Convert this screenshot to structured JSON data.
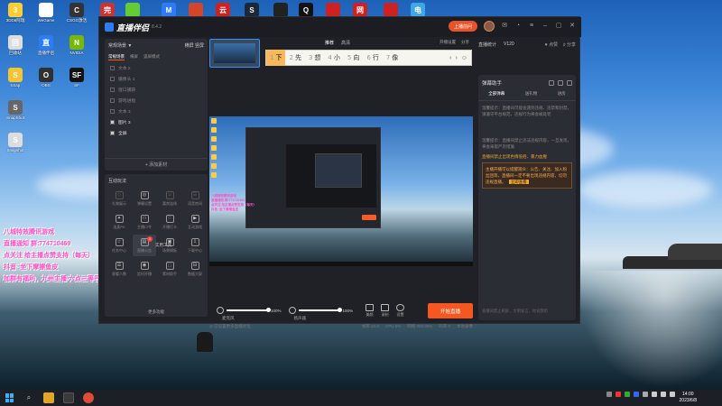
{
  "desktop": {
    "icons": [
      {
        "label": "3DD6阿瑞",
        "color": "#ffcc33",
        "glyph": "3"
      },
      {
        "label": "WeGame",
        "color": "#ffffff",
        "glyph": "W"
      },
      {
        "label": "CSGO激活",
        "color": "#333333",
        "glyph": "C"
      },
      {
        "label": "完美",
        "color": "#cc3333",
        "glyph": "完"
      },
      {
        "label": "",
        "color": "#66cc33",
        "glyph": ""
      },
      {
        "label": "Microsoft",
        "color": "#2d7bf5",
        "glyph": "M"
      },
      {
        "label": "",
        "color": "#d4462b",
        "glyph": ""
      },
      {
        "label": "网易云",
        "color": "#cc2222",
        "glyph": "云"
      },
      {
        "label": "Steam",
        "color": "#1b2838",
        "glyph": "S"
      },
      {
        "label": "",
        "color": "#222222",
        "glyph": ""
      },
      {
        "label": "QQ",
        "color": "#111111",
        "glyph": "Q"
      },
      {
        "label": "",
        "color": "#cc2222",
        "glyph": ""
      },
      {
        "label": "网易",
        "color": "#cc2222",
        "glyph": "网"
      },
      {
        "label": "",
        "color": "#cc2222",
        "glyph": ""
      },
      {
        "label": "此电脑",
        "color": "#3fa7e8",
        "glyph": "电"
      },
      {
        "label": "回收站",
        "color": "#dddddd",
        "glyph": "回"
      },
      {
        "label": "直播伴侣",
        "color": "#2d7bf5",
        "glyph": "直"
      },
      {
        "label": "NVIDIA",
        "color": "#76b900",
        "glyph": "N"
      },
      {
        "label": "Snap",
        "color": "#f4c431",
        "glyph": "S"
      },
      {
        "label": "OBS",
        "color": "#303030",
        "glyph": "O"
      },
      {
        "label": "SF",
        "color": "#111111",
        "glyph": "SF"
      },
      {
        "label": "SnapShot",
        "color": "#666666",
        "glyph": "S"
      },
      {
        "label": "Snapshot",
        "color": "#dddddd",
        "glyph": "S"
      }
    ]
  },
  "overlay": {
    "lines": [
      "八城特效腾讯游戏",
      "直播通知 群:774710469",
      "点关注 给主播点赞支持（每天）",
      "抖音 :坐下摩擦鱼皮",
      "加群有福利，九州主播 六点三等巴江"
    ]
  },
  "app": {
    "name": "直播伴侣",
    "version": "8.4.2",
    "live_label": "上播前问",
    "left": {
      "scene_title": "常规场景 ▼",
      "scene_actions": [
        "横屏",
        "竖屏"
      ],
      "tabs": [
        "常规场景",
        "横屏",
        "竖屏模式"
      ],
      "sources": [
        {
          "label": "文本 2",
          "on": false
        },
        {
          "label": "摄像头 1",
          "on": false
        },
        {
          "label": "窗口捕获",
          "on": false
        },
        {
          "label": "游戏进程",
          "on": false
        },
        {
          "label": "文本 3",
          "on": false
        },
        {
          "label": "图片 3",
          "on": true
        },
        {
          "label": "全屏",
          "on": true
        }
      ],
      "add_source": "+ 添加素材",
      "tools_title": "互动玩法",
      "tools": [
        {
          "label": "礼物展示",
          "icon": "◇",
          "dim": true
        },
        {
          "label": "弹幕设置",
          "icon": "◎",
          "dim": false
        },
        {
          "label": "嘉宾连线",
          "icon": "☺",
          "dim": true
        },
        {
          "label": "语音房间",
          "icon": "☷",
          "dim": true
        },
        {
          "label": "连麦PK",
          "icon": "✦",
          "dim": false
        },
        {
          "label": "主播口令",
          "icon": "□",
          "dim": false
        },
        {
          "label": "开播打卡",
          "icon": "♡",
          "dim": false
        },
        {
          "label": "互动游戏",
          "icon": "▶",
          "dim": false
        },
        {
          "label": "任务中心",
          "icon": "☆",
          "dim": false
        },
        {
          "label": "直播公告",
          "icon": "▤",
          "dim": false,
          "hi": true,
          "badge": "1"
        },
        {
          "label": "场景模板",
          "icon": "▣",
          "dim": false
        },
        {
          "label": "下载中心",
          "icon": "⇩",
          "dim": false
        },
        {
          "label": "观看人数",
          "icon": "☰",
          "dim": false
        },
        {
          "label": "定时开播",
          "icon": "◉",
          "dim": false
        },
        {
          "label": "素材助手",
          "icon": "⬚",
          "dim": false
        },
        {
          "label": "数据大屏",
          "icon": "⊟",
          "dim": false
        }
      ],
      "tools_extra": "实用工具",
      "more": "更多功能"
    },
    "middle": {
      "tabs": [
        "推荐",
        "高清"
      ],
      "mic_labels": [
        "开播设置",
        "分享"
      ],
      "ime": {
        "candidates": [
          {
            "num": "1",
            "text": "下"
          },
          {
            "num": "2",
            "text": "先"
          },
          {
            "num": "3",
            "text": "想"
          },
          {
            "num": "4",
            "text": "小"
          },
          {
            "num": "5",
            "text": "向"
          },
          {
            "num": "6",
            "text": "行"
          },
          {
            "num": "7",
            "text": "像"
          }
        ],
        "controls": [
          "‹",
          "›",
          "☺"
        ]
      },
      "controls": {
        "mic_label": "麦克风",
        "mic_pct": "100%",
        "mic_level": 100,
        "speaker_label": "扬声器",
        "speaker_pct": "100%",
        "speaker_level": 100,
        "buttons": [
          "美颜",
          "录制",
          "设置"
        ],
        "start_label": "开始直播"
      },
      "status": {
        "left": "◎ 已设置更多直播优化",
        "items": [
          "帧率 24.0",
          "CPU 5%",
          "网络 000.00%",
          "码率 0",
          "本地录像"
        ]
      }
    },
    "right": {
      "top_tabs": [
        "直播统计",
        "V120"
      ],
      "top_actions": [
        "♥ 点赞",
        "♯ 分享"
      ],
      "panel_title": "弹幕助手",
      "panel_tabs": [
        "全部弹幕",
        "送礼物",
        "进房"
      ],
      "notice1": "温馨提示：直播间可能会遇到违规、违禁和封禁，请遵守平台规范，违规行为将会被处罚",
      "notice2": "温馨提示：直播间禁止违法违规内容，一旦发现，将会采取严厉措施",
      "alert": "直播间禁止出现色情低俗、暴力血腥",
      "box": "主播开播可以提醒观众：公告、关注、加入粉丝团等，直播间一定不要出现违规内容，切勿违规直播。",
      "box_tag": "立即查看",
      "input_placeholder": "直播间禁止刷屏，文明发言，你说我听"
    }
  },
  "taskbar": {
    "time": "14:00",
    "date": "2023/6/8"
  }
}
